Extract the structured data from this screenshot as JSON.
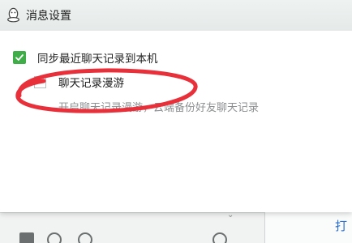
{
  "dialog": {
    "title": "消息设置",
    "icon": "qq-penguin-icon"
  },
  "settings": {
    "sync_label": "同步最近聊天记录到本机",
    "sync_checked": true,
    "roaming_label": "聊天记录漫游",
    "roaming_checked": false,
    "roaming_description": "开启聊天记录漫游，云端备份好友聊天记录"
  },
  "background": {
    "right_link": "打"
  },
  "colors": {
    "check_green": "#3fae49",
    "annotation_red": "#e8303a",
    "link_blue": "#2a6fd0"
  }
}
